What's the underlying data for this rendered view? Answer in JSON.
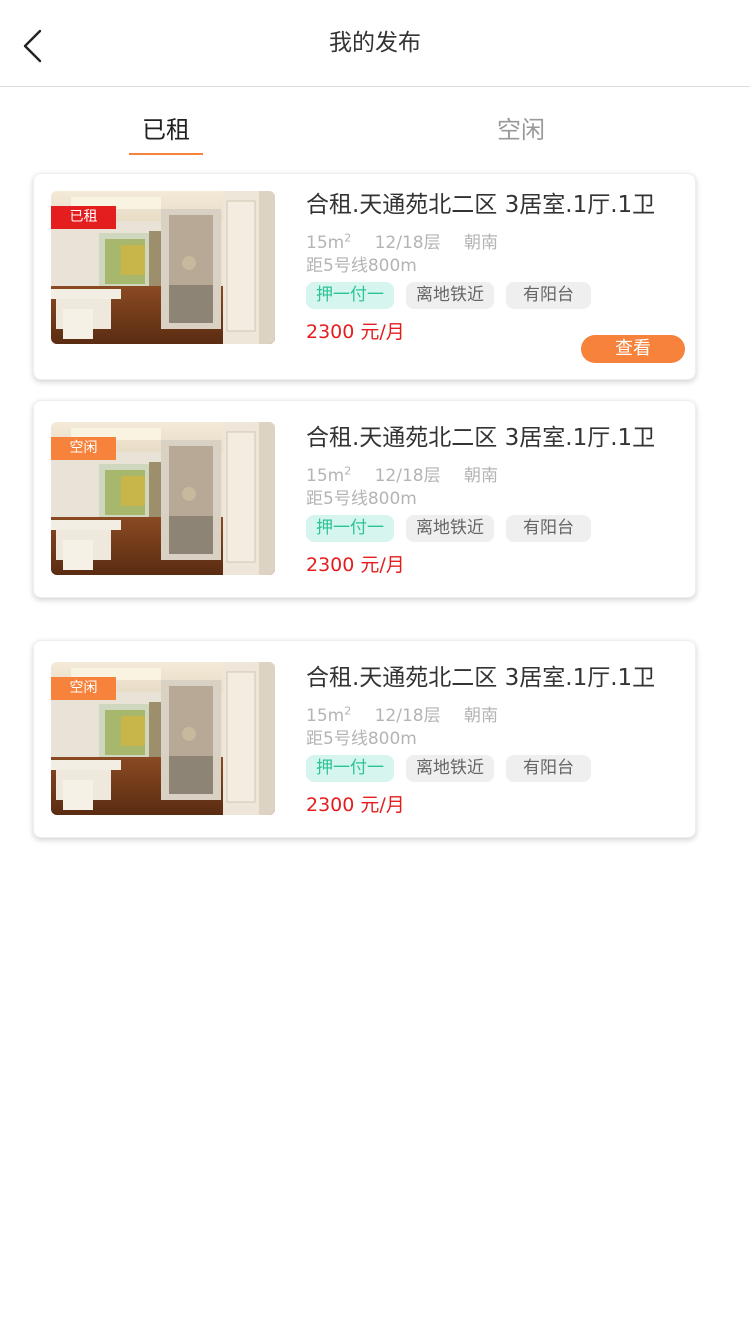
{
  "header": {
    "title": "我的发布",
    "back_icon": "chevron-left-icon"
  },
  "tabs": [
    {
      "label": "已租",
      "active": true
    },
    {
      "label": "空闲",
      "active": false
    }
  ],
  "colors": {
    "accent": "#f7823b",
    "price": "#e41e1e",
    "rented_badge": "#e41e1e",
    "idle_badge": "#f7823b",
    "tag_green": "#2cc496"
  },
  "listings": [
    {
      "status": "已租",
      "title": "合租.天通苑北二区 3居室.1厅.1卫",
      "area": "15m",
      "area_unit_sup": "2",
      "floor": "12/18层",
      "orientation": "朝南",
      "distance": "距5号线800m",
      "tags": [
        "押一付一",
        "离地铁近",
        "有阳台"
      ],
      "price": "2300 元/月",
      "action_label": "查看"
    },
    {
      "status": "空闲",
      "title": "合租.天通苑北二区 3居室.1厅.1卫",
      "area": "15m",
      "area_unit_sup": "2",
      "floor": "12/18层",
      "orientation": "朝南",
      "distance": "距5号线800m",
      "tags": [
        "押一付一",
        "离地铁近",
        "有阳台"
      ],
      "price": "2300 元/月"
    },
    {
      "status": "空闲",
      "title": "合租.天通苑北二区 3居室.1厅.1卫",
      "area": "15m",
      "area_unit_sup": "2",
      "floor": "12/18层",
      "orientation": "朝南",
      "distance": "距5号线800m",
      "tags": [
        "押一付一",
        "离地铁近",
        "有阳台"
      ],
      "price": "2300 元/月"
    }
  ]
}
